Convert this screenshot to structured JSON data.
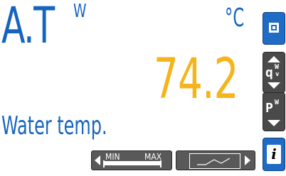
{
  "display": {
    "code": "A.T",
    "code_superscript": "W",
    "unit": "°C",
    "value": "74.2",
    "description": "Water temp."
  },
  "sidebar": {
    "mode_button_icon": "mode-square-icon",
    "updown_button_icon": "up-down-arrows-icon",
    "updown_button_letter": "q",
    "updown_button_sup": "W",
    "updown_button_sub": "v",
    "pw_button_letter": "P",
    "pw_button_sup": "W",
    "info_button_label": "i"
  },
  "bottom_bar": {
    "minmax_min_label": "MIN",
    "minmax_max_label": "MAX",
    "graph_icon": "trend-graph-icon"
  },
  "colors": {
    "primary_blue": "#1565c0",
    "value_amber": "#f5b419",
    "button_blue": "#1f6cc6",
    "button_grey": "#4a4a4a"
  }
}
